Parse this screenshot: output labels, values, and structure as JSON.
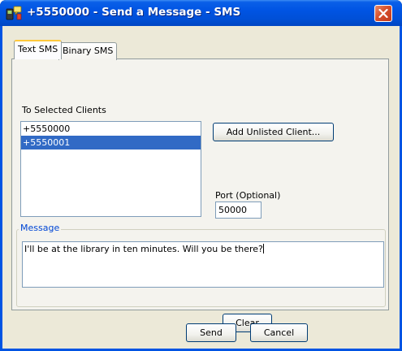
{
  "window": {
    "title": "+5550000 - Send a Message - SMS",
    "app_icon": "phone-sms-icon",
    "close_icon": "close-icon",
    "accent_color": "#0054e3",
    "close_color": "#d6502d"
  },
  "tabs": [
    {
      "label": "Text SMS",
      "selected": true
    },
    {
      "label": "Binary SMS",
      "selected": false
    }
  ],
  "recipients": {
    "label": "To Selected Clients",
    "items": [
      {
        "value": "+5550000",
        "selected": false
      },
      {
        "value": "+5550001",
        "selected": true
      }
    ],
    "add_button_label": "Add Unlisted Client..."
  },
  "port": {
    "label": "Port (Optional)",
    "value": "50000"
  },
  "message": {
    "legend": "Message",
    "text": "I'll be at the library in ten minutes. Will you be there?",
    "clear_label": "Clear"
  },
  "footer": {
    "send_label": "Send",
    "cancel_label": "Cancel"
  }
}
